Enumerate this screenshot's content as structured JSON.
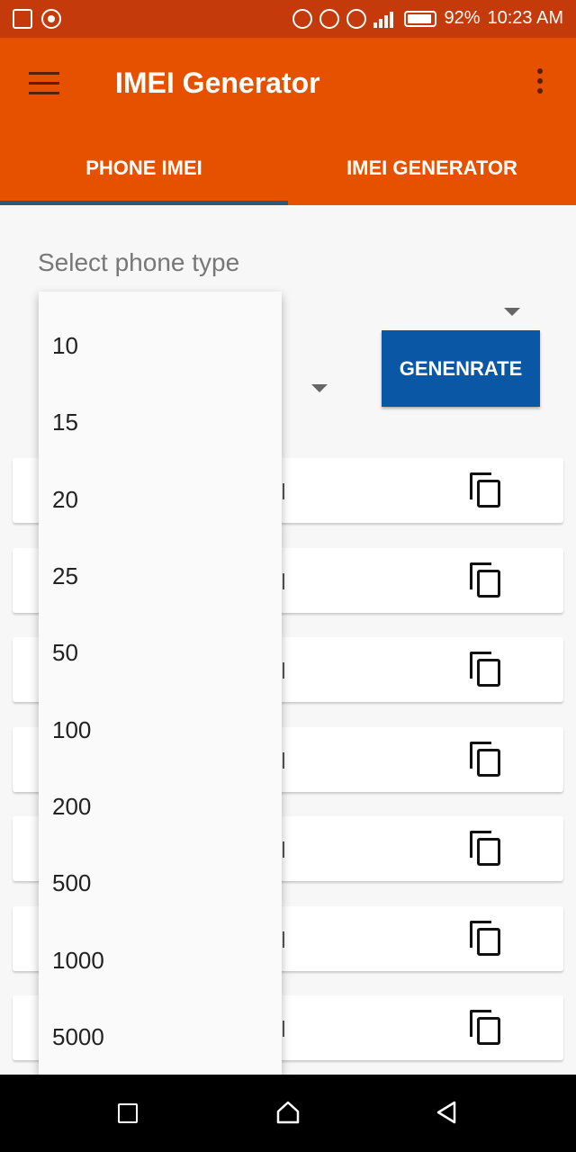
{
  "status_bar": {
    "battery": "92%",
    "time": "10:23 AM"
  },
  "app_bar": {
    "title": "IMEI Generator"
  },
  "tabs": [
    {
      "label": "PHONE IMEI",
      "selected": true
    },
    {
      "label": "IMEI GENERATOR",
      "selected": false
    }
  ],
  "form": {
    "select_phone_type_label": "Select  phone type",
    "generate_button_label": "GENENRATE"
  },
  "quantity_dropdown": {
    "options": [
      "10",
      "15",
      "20",
      "25",
      "50",
      "100",
      "200",
      "500",
      "1000",
      "5000"
    ]
  },
  "results": {
    "row_count": 7
  },
  "colors": {
    "status_bar": "#c53a0a",
    "app_bar": "#e65100",
    "tab_indicator": "#2c5a7a",
    "generate_button": "#0a57a5"
  }
}
